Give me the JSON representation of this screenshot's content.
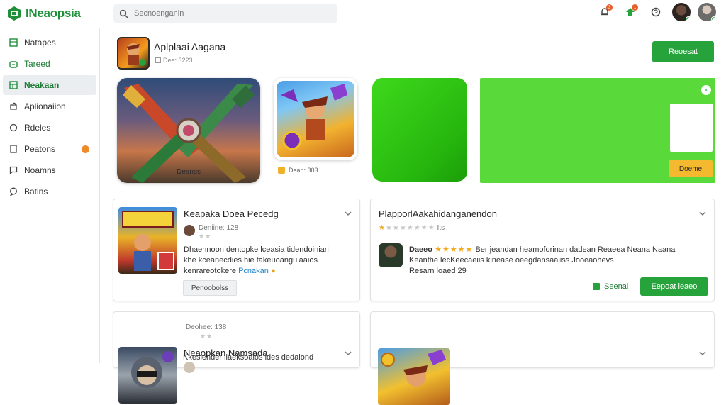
{
  "app": {
    "name": "INeaopsia",
    "brand_color": "#1f8f3a",
    "accent_color": "#27a33c"
  },
  "search": {
    "placeholder": "Secnoenganin",
    "icon": "search-icon"
  },
  "topbar": {
    "notifications_badge": "3",
    "updates_badge": "1"
  },
  "sidebar": {
    "items": [
      {
        "label": "Natapes",
        "icon": "grid-icon",
        "active": false
      },
      {
        "label": "Tareed",
        "icon": "store-icon",
        "active": false
      },
      {
        "label": "Neakaan",
        "icon": "apps-icon",
        "active": true
      },
      {
        "label": "Aplionaiion",
        "icon": "puzzle-icon",
        "active": false
      },
      {
        "label": "Rdeles",
        "icon": "circle-icon",
        "active": false
      },
      {
        "label": "Peatons",
        "icon": "document-icon",
        "active": false,
        "badge": true
      },
      {
        "label": "Noamns",
        "icon": "chat-icon",
        "active": false
      },
      {
        "label": "Batins",
        "icon": "message-icon",
        "active": false
      }
    ]
  },
  "header": {
    "title": "Aplplaai Aagana",
    "subtitle": "Dee: 3223",
    "button_label": "Reoesat"
  },
  "gallery": {
    "shot1_label": "Deanss",
    "shot2_caption": "Dean: 303",
    "shot4_button": "Doeme"
  },
  "cards": [
    {
      "title": "Keapaka Doea Pecedg",
      "meta": "Deniine: 128",
      "desc_lines": [
        "Dhaennoon dentopke lceasia tidendoiniari",
        "khe kceanecdies hie takeuoangulaaios",
        "kenrareotokere"
      ],
      "link": "Pcnakan",
      "button": "Penoobolss"
    },
    {
      "title": "PlapporlAakahidanganendon",
      "rating_label": "Its",
      "reviewer": "Daeeo",
      "desc_lines": [
        "Ber jeandan heamoforinan dadean Reaeea Neana Naana",
        "Keanthe lecKeecaeiis kinease oeegdansaaiiss Jooeaohevs",
        "Resarn loaed 29"
      ],
      "link_label": "Seenal",
      "button": "Eepoat leaeo"
    },
    {
      "title": "Neaopkan Namsada",
      "meta": "Deohee: 138",
      "desc_lines": [
        "Kkeslender liaeksoaios ldes dedalond"
      ]
    },
    {
      "title": ""
    }
  ]
}
